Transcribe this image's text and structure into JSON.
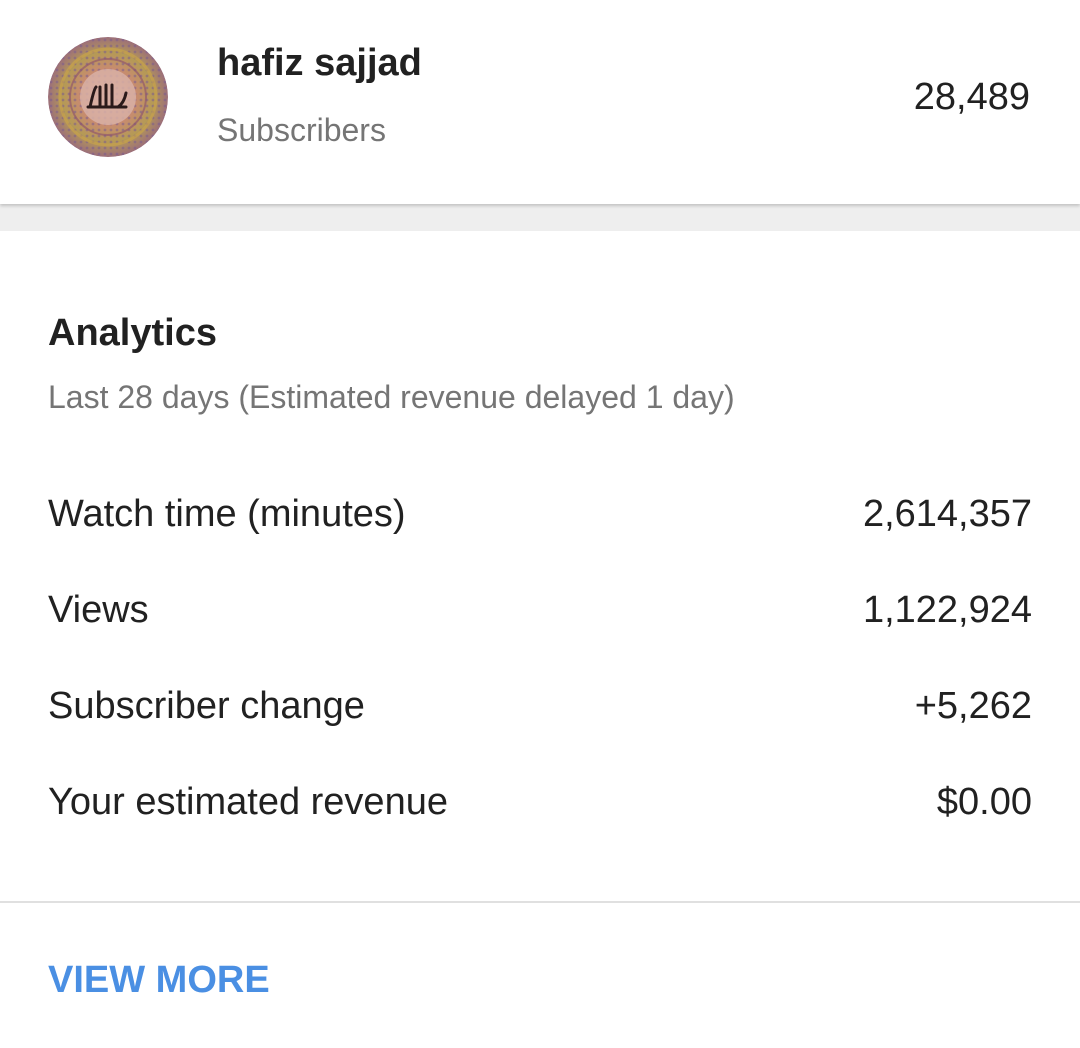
{
  "channel": {
    "name": "hafiz sajjad",
    "subscribers_label": "Subscribers",
    "subscribers_count": "28,489",
    "avatar_icon": "calligraphy-avatar-icon"
  },
  "analytics": {
    "title": "Analytics",
    "subtitle": "Last 28 days (Estimated revenue delayed 1 day)",
    "metrics": [
      {
        "label": "Watch time (minutes)",
        "value": "2,614,357"
      },
      {
        "label": "Views",
        "value": "1,122,924"
      },
      {
        "label": "Subscriber change",
        "value": "+5,262"
      },
      {
        "label": "Your estimated revenue",
        "value": "$0.00"
      }
    ],
    "view_more_label": "VIEW MORE"
  },
  "colors": {
    "text_primary": "#212121",
    "text_secondary": "#757575",
    "link_blue": "#4a8fe3",
    "separator_band": "#eeeeee",
    "divider": "#e0e0e0"
  }
}
